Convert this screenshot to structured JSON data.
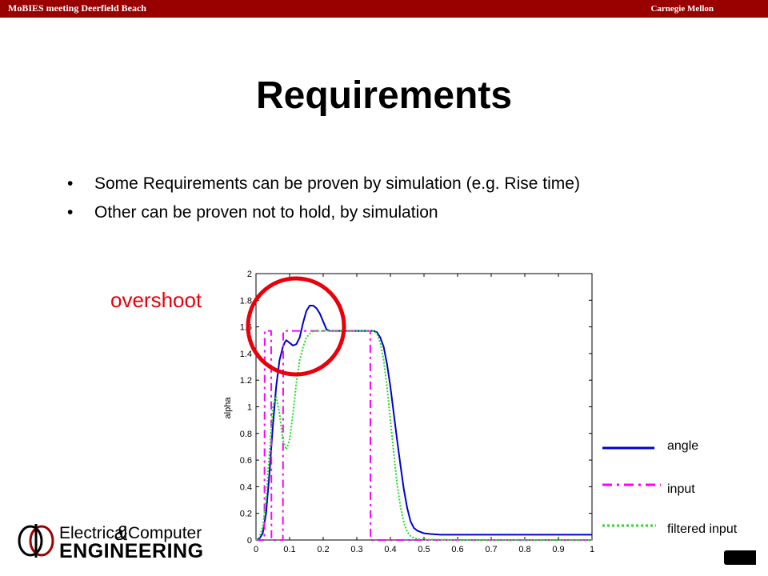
{
  "header": {
    "left_text": "MoBIES meeting Deerfield Beach",
    "right_text": "Carnegie Mellon"
  },
  "slide": {
    "title": "Requirements",
    "bullets": [
      "Some Requirements can be proven by simulation (e.g. Rise time)",
      "Other can be proven not to hold, by simulation"
    ],
    "bullet_glyph": "•",
    "overshoot_label": "overshoot"
  },
  "logo": {
    "line1_a": "Electrical",
    "line1_amp": "&",
    "line1_b": "Computer",
    "line2": "ENGINEERING"
  },
  "colors": {
    "header": "#990000",
    "angle": "#0000cc",
    "input": "#ff00ff",
    "filtered": "#22dd22",
    "highlight": "#e8000b"
  },
  "chart_data": {
    "type": "line",
    "ylabel": "alpha",
    "xlabel": "",
    "xlim": [
      0,
      1
    ],
    "ylim": [
      0,
      2
    ],
    "xticks": [
      0,
      0.1,
      0.2,
      0.3,
      0.4,
      0.5,
      0.6,
      0.7,
      0.8,
      0.9,
      1
    ],
    "xtick_labels": [
      "0",
      "0.1",
      "0.2",
      "0.3",
      "0.4",
      "0.5",
      "0.6",
      "0.7",
      "0.8",
      "0.9",
      "1"
    ],
    "yticks": [
      0,
      0.2,
      0.4,
      0.6,
      0.8,
      1,
      1.2,
      1.4,
      1.6,
      1.8,
      2
    ],
    "ytick_labels": [
      "0",
      "0.2",
      "0.4",
      "0.6",
      "0.8",
      "1",
      "1.2",
      "1.4",
      "1.6",
      "1.8",
      "2"
    ],
    "grid": false,
    "legend_placement": "right",
    "series": [
      {
        "name": "angle",
        "style": "solid",
        "x": [
          0,
          0.01,
          0.02,
          0.03,
          0.04,
          0.05,
          0.06,
          0.07,
          0.08,
          0.085,
          0.09,
          0.1,
          0.11,
          0.12,
          0.13,
          0.14,
          0.15,
          0.16,
          0.17,
          0.18,
          0.19,
          0.2,
          0.21,
          0.22,
          0.25,
          0.3,
          0.35,
          0.36,
          0.37,
          0.38,
          0.39,
          0.4,
          0.41,
          0.42,
          0.43,
          0.44,
          0.45,
          0.46,
          0.47,
          0.48,
          0.5,
          0.52,
          0.55,
          0.6,
          0.7,
          0.8,
          0.9,
          1.0
        ],
        "y": [
          0,
          0.01,
          0.05,
          0.2,
          0.5,
          0.85,
          1.15,
          1.35,
          1.45,
          1.48,
          1.5,
          1.48,
          1.46,
          1.47,
          1.52,
          1.63,
          1.72,
          1.76,
          1.76,
          1.74,
          1.7,
          1.64,
          1.58,
          1.57,
          1.57,
          1.57,
          1.57,
          1.56,
          1.52,
          1.45,
          1.32,
          1.15,
          0.95,
          0.75,
          0.56,
          0.38,
          0.24,
          0.14,
          0.09,
          0.07,
          0.05,
          0.045,
          0.04,
          0.04,
          0.04,
          0.04,
          0.04,
          0.04
        ]
      },
      {
        "name": "input",
        "style": "dash-dot",
        "x": [
          0,
          0.01,
          0.02,
          0.025,
          0.026,
          0.045,
          0.046,
          0.08,
          0.081,
          0.34,
          0.341,
          1.0
        ],
        "y": [
          0,
          0,
          0,
          0,
          1.57,
          1.57,
          0,
          0,
          1.57,
          1.57,
          0,
          0
        ]
      },
      {
        "name": "filtered input",
        "style": "dotted",
        "x": [
          0,
          0.01,
          0.02,
          0.03,
          0.04,
          0.05,
          0.06,
          0.07,
          0.08,
          0.09,
          0.1,
          0.11,
          0.12,
          0.13,
          0.14,
          0.15,
          0.16,
          0.17,
          0.18,
          0.19,
          0.2,
          0.22,
          0.25,
          0.3,
          0.35,
          0.36,
          0.37,
          0.38,
          0.39,
          0.4,
          0.41,
          0.42,
          0.43,
          0.44,
          0.45,
          0.46,
          0.47,
          0.48,
          0.5,
          0.55,
          0.6,
          0.7,
          0.8,
          0.9,
          1.0
        ],
        "y": [
          0,
          0.02,
          0.1,
          0.3,
          0.65,
          1.0,
          1.08,
          0.95,
          0.75,
          0.68,
          0.75,
          0.95,
          1.18,
          1.35,
          1.45,
          1.52,
          1.55,
          1.57,
          1.57,
          1.57,
          1.57,
          1.57,
          1.57,
          1.57,
          1.57,
          1.55,
          1.48,
          1.35,
          1.15,
          0.9,
          0.65,
          0.42,
          0.25,
          0.13,
          0.06,
          0.03,
          0.015,
          0.008,
          0.004,
          0.002,
          0.001,
          0,
          0,
          0,
          0
        ]
      }
    ]
  }
}
